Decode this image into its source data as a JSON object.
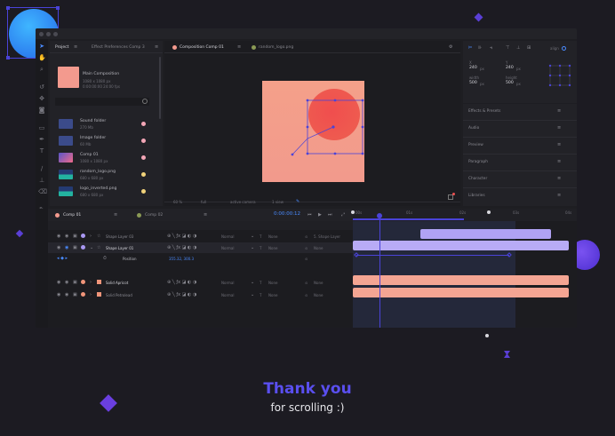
{
  "project_tabs": [
    "Project",
    "Effect Preferences Comp 3"
  ],
  "comp_tabs": [
    "Composition Comp 01",
    "random_logo.png"
  ],
  "main_comp": {
    "name": "Main Composition",
    "size": "1080 x 1080 px",
    "duration": "0:00:00:00 24:00 fps"
  },
  "project_items": [
    {
      "name": "Sound folder",
      "meta": "270 Mb",
      "kind": "folder",
      "color": "#f3a6b6"
    },
    {
      "name": "Image folder",
      "meta": "60 Mb",
      "kind": "folder",
      "color": "#f3a6b6"
    },
    {
      "name": "Comp 01",
      "meta": "1080 x 1080 px",
      "kind": "comp",
      "color": "#f3a6b6"
    },
    {
      "name": "random_logo.png",
      "meta": "680 x 680 px",
      "kind": "image",
      "color": "#f0d27a"
    },
    {
      "name": "logo_inverted.png",
      "meta": "680 x 680 px",
      "kind": "image",
      "color": "#f0d27a"
    }
  ],
  "viewer_bar": [
    "60 %",
    "full",
    "active camera",
    "1 view"
  ],
  "align": {
    "label": "align",
    "x_label": "X",
    "x": "240",
    "y_label": "Y",
    "y": "240",
    "w_label": "width",
    "w": "500",
    "h_label": "height",
    "h": "500",
    "unit": "px"
  },
  "side_panels": [
    "Effects & Presets",
    "Audio",
    "Preview",
    "Paragraph",
    "Character",
    "Libraries"
  ],
  "timeline_tabs": [
    "Comp 01",
    "Comp 02"
  ],
  "timecode": "0:00:00:12",
  "ruler": [
    "00s",
    "01s",
    "02s",
    "03s",
    "04s"
  ],
  "layers": [
    {
      "name": "Shape Layer 03",
      "color": "#a998f2",
      "mode": "Normal",
      "track": "None",
      "parent": "5. Shape Layer",
      "active": false
    },
    {
      "name": "Shape Layer 01",
      "color": "#a998f2",
      "mode": "Normal",
      "track": "None",
      "parent": "None",
      "active": true
    },
    {
      "name": "Solid Apricot",
      "color": "#f0957a",
      "mode": "Normal",
      "track": "None",
      "parent": "None",
      "active": false
    },
    {
      "name": "Solid Petrolead",
      "color": "#f0957a",
      "mode": "Normal",
      "track": "None",
      "parent": "None",
      "active": false
    }
  ],
  "position_prop": {
    "label": "Position",
    "value": "355.32, 300.3"
  },
  "colors": {
    "accent": "#4a43d8",
    "pink": "#f39a8e",
    "red": "#ef4f4f",
    "purple": "#a998f2",
    "orange": "#f0957a"
  },
  "footer": {
    "title": "Thank you",
    "subtitle": "for scrolling :)"
  },
  "misc": {
    "bpc": "8 bpc"
  }
}
